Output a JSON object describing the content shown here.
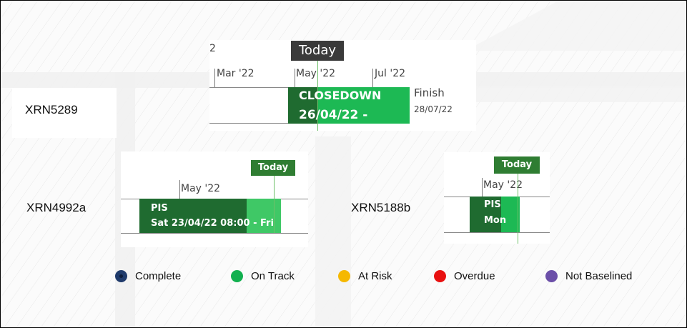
{
  "colors": {
    "dark_green": "#1f6b30",
    "green": "#1db954",
    "light_green": "#3fc866",
    "today_dark": "#3a3a3a",
    "today_green": "#2f7d32",
    "complete": "#1f3a6b",
    "on_track": "#12b04f",
    "at_risk": "#f5b800",
    "overdue": "#e81010",
    "not_baselined": "#6b4fa8"
  },
  "snippet_xrn5289": {
    "row_label": "XRN5289",
    "today_label": "Today",
    "partial_tick": "2",
    "ticks": [
      "Mar '22",
      "May '22",
      "Jul '22"
    ],
    "bar_line1": "CLOSEDOWN",
    "bar_line2": "26/04/22 -",
    "finish_label": "Finish",
    "finish_date": "28/07/22"
  },
  "snippet_xrn4992a": {
    "row_label": "XRN4992a",
    "today_label": "Today",
    "tick": "May '22",
    "bar_line1": "PIS",
    "bar_line2": "Sat 23/04/22 08:00 - Fri"
  },
  "snippet_xrn5188b": {
    "row_label": "XRN5188b",
    "today_label": "Today",
    "tick": "May '22",
    "bar_line1": "PIS",
    "bar_line2": "Mon"
  },
  "legend": [
    {
      "label": "Complete",
      "status": "complete",
      "icon": "complete-dot-icon"
    },
    {
      "label": "On Track",
      "status": "on_track",
      "icon": "on-track-dot-icon"
    },
    {
      "label": "At Risk",
      "status": "at_risk",
      "icon": "at-risk-dot-icon"
    },
    {
      "label": "Overdue",
      "status": "overdue",
      "icon": "overdue-dot-icon"
    },
    {
      "label": "Not Baselined",
      "status": "not_baselined",
      "icon": "not-baselined-dot-icon"
    }
  ]
}
